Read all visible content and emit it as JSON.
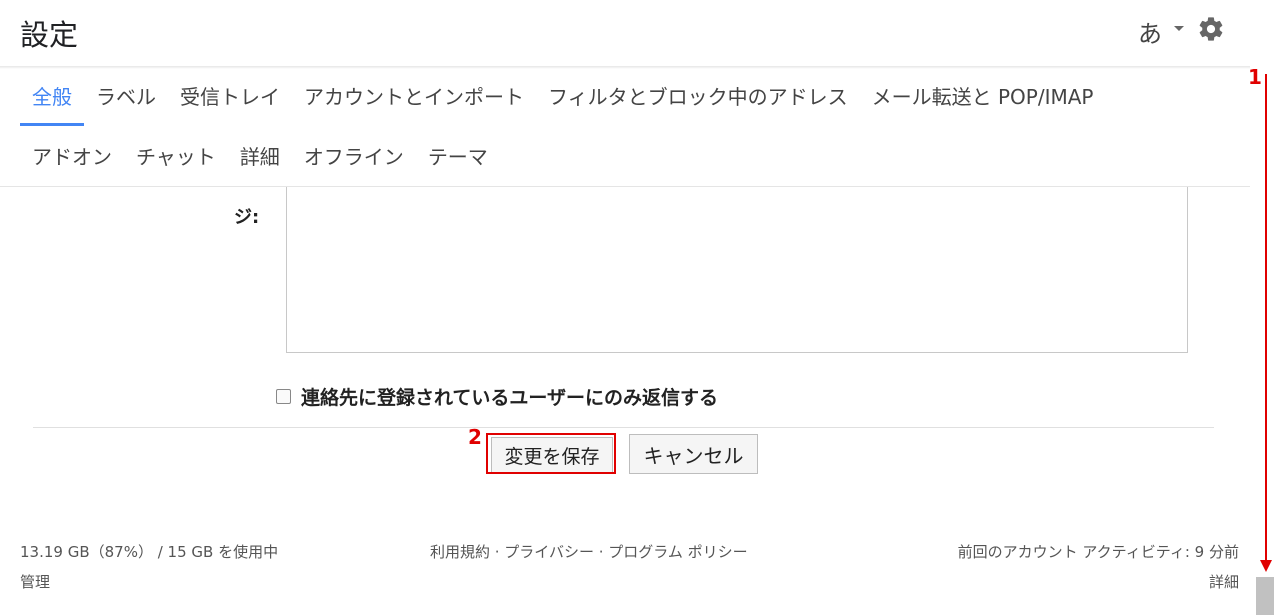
{
  "header": {
    "title": "設定",
    "lang_label": "あ",
    "settings_icon": "gear-icon"
  },
  "tabs": {
    "row1": [
      {
        "label": "全般",
        "active": true
      },
      {
        "label": "ラベル",
        "active": false
      },
      {
        "label": "受信トレイ",
        "active": false
      },
      {
        "label": "アカウントとインポート",
        "active": false
      },
      {
        "label": "フィルタとブロック中のアドレス",
        "active": false
      },
      {
        "label": "メール転送と POP/IMAP",
        "active": false
      }
    ],
    "row2": [
      {
        "label": "アドオン",
        "active": false
      },
      {
        "label": "チャット",
        "active": false
      },
      {
        "label": "詳細",
        "active": false
      },
      {
        "label": "オフライン",
        "active": false
      },
      {
        "label": "テーマ",
        "active": false
      }
    ]
  },
  "settings": {
    "signature_label_tail": "ジ:",
    "signature_value": "",
    "contacts_only_label": "連絡先に登録されているユーザーにのみ返信する",
    "contacts_only_checked": false
  },
  "actions": {
    "save_label": "変更を保存",
    "cancel_label": "キャンセル"
  },
  "callouts": {
    "step1": "1",
    "step2": "2"
  },
  "footer": {
    "storage": "13.19 GB（87%） / 15 GB を使用中",
    "manage": "管理",
    "links": "利用規約 · プライバシー · プログラム ポリシー",
    "last_activity": "前回のアカウント アクティビティ: 9 分前",
    "details": "詳細"
  },
  "colors": {
    "accent": "#4285f4",
    "highlight": "#e00000"
  }
}
